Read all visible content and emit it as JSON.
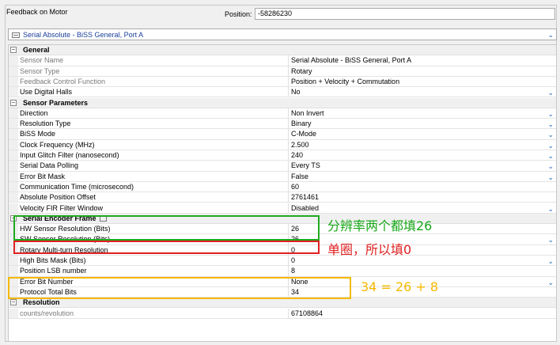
{
  "header": {
    "title": "Feedback on Motor",
    "position_label": "Position:",
    "position_value": "-58286230"
  },
  "feedback_select": {
    "value": "Serial Absolute - BiSS General, Port A"
  },
  "grid": {
    "general": {
      "label": "General",
      "rows": [
        {
          "name": "Sensor Name",
          "value": "Serial Absolute - BiSS General, Port A"
        },
        {
          "name": "Sensor Type",
          "value": "Rotary"
        },
        {
          "name": "Feedback Control Function",
          "value": "Position + Velocity + Commutation"
        },
        {
          "name": "Use Digital Halls",
          "value": "No"
        }
      ]
    },
    "sensor_parameters": {
      "label": "Sensor Parameters",
      "rows": [
        {
          "name": "Direction",
          "value": "Non Invert"
        },
        {
          "name": "Resolution Type",
          "value": "Binary"
        },
        {
          "name": "BiSS Mode",
          "value": "C-Mode"
        },
        {
          "name": "Clock Frequency (MHz)",
          "value": "2.500"
        },
        {
          "name": "Input Glitch Filter (nanosecond)",
          "value": "240"
        },
        {
          "name": "Serial Data Polling",
          "value": "Every TS"
        },
        {
          "name": "Error Bit Mask",
          "value": "False"
        },
        {
          "name": "Communication Time (microsecond)",
          "value": "60"
        },
        {
          "name": "Absolute Position Offset",
          "value": "2761461"
        },
        {
          "name": "Velocity FIR Filter Window",
          "value": "Disabled"
        }
      ]
    },
    "serial_encoder_frame": {
      "label": "Serial Encoder Frame",
      "rows": [
        {
          "name": "HW Sensor Resolution (Bits)",
          "value": "26"
        },
        {
          "name": "SW Sensor Resolution (Bits)",
          "value": "26"
        },
        {
          "name": "Rotary Multi-turn Resolution",
          "value": "0"
        },
        {
          "name": "High Bits Mask (Bits)",
          "value": "0"
        },
        {
          "name": "Position LSB number",
          "value": "8"
        },
        {
          "name": "Error Bit Number",
          "value": "None"
        },
        {
          "name": "Protocol Total Bits",
          "value": "34"
        }
      ]
    },
    "resolution": {
      "label": "Resolution",
      "rows": [
        {
          "name": "counts/revolution",
          "value": "67108864"
        }
      ]
    }
  },
  "annotations": {
    "green": "分辨率两个都填26",
    "red": "单圈，所以填0",
    "orange": "34 = 26 + 8"
  },
  "colors": {
    "annotation_green": "#1eaa1e",
    "annotation_red": "#e02020",
    "annotation_orange": "#f5b800"
  }
}
